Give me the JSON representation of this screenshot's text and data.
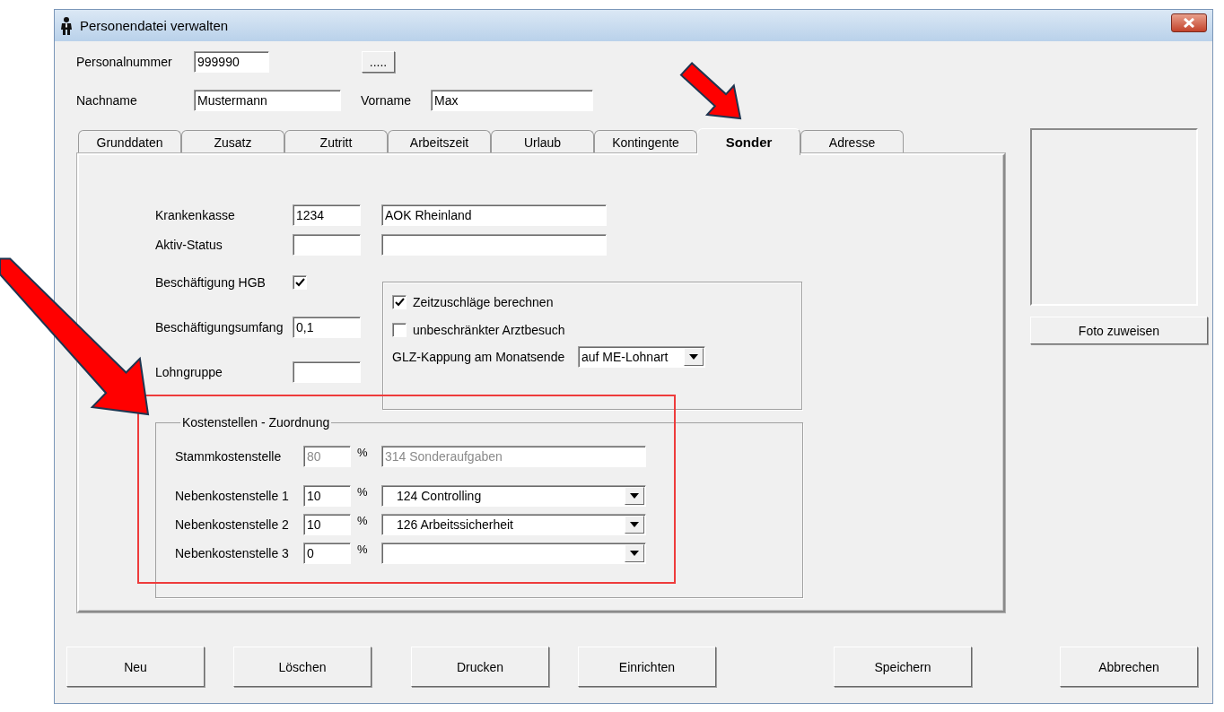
{
  "window": {
    "title": "Personendatei verwalten"
  },
  "header": {
    "personalnummer": {
      "label": "Personalnummer",
      "value": "999990"
    },
    "lookup_button": ".....",
    "nachname": {
      "label": "Nachname",
      "value": "Mustermann"
    },
    "vorname": {
      "label": "Vorname",
      "value": "Max"
    }
  },
  "tabs": [
    {
      "label": "Grunddaten",
      "selected": false
    },
    {
      "label": "Zusatz",
      "selected": false
    },
    {
      "label": "Zutritt",
      "selected": false
    },
    {
      "label": "Arbeitszeit",
      "selected": false
    },
    {
      "label": "Urlaub",
      "selected": false
    },
    {
      "label": "Kontingente",
      "selected": false
    },
    {
      "label": "Sonder",
      "selected": true
    },
    {
      "label": "Adresse",
      "selected": false
    }
  ],
  "sonder": {
    "krankenkasse": {
      "label": "Krankenkasse",
      "code": "1234",
      "name": "AOK Rheinland"
    },
    "aktiv_status": {
      "label": "Aktiv-Status"
    },
    "beschaeftigung_hgb": {
      "label": "Beschäftigung HGB",
      "checked": true
    },
    "beschaeftigungsumfang": {
      "label": "Beschäftigungsumfang",
      "value": "0,1"
    },
    "lohngruppe": {
      "label": "Lohngruppe"
    },
    "options": [
      {
        "label": "Zeitzuschläge berechnen",
        "checked": true
      },
      {
        "label": "unbeschränkter Arztbesuch",
        "checked": false
      }
    ],
    "glz_kappung": {
      "label": "GLZ-Kappung am Monatsende",
      "value": "auf ME-Lohnart"
    },
    "kostenstellen": {
      "title": "Kostenstellen - Zuordnung",
      "stamm": {
        "label": "Stammkostenstelle",
        "percent": "80",
        "unit": "%",
        "name": "314 Sonderaufgaben",
        "disabled": true
      },
      "neben": [
        {
          "label": "Nebenkostenstelle 1",
          "percent": "10",
          "unit": "%",
          "value": "124 Controlling"
        },
        {
          "label": "Nebenkostenstelle 2",
          "percent": "10",
          "unit": "%",
          "value": "126 Arbeitssicherheit"
        },
        {
          "label": "Nebenkostenstelle 3",
          "percent": "0",
          "unit": "%"
        }
      ]
    }
  },
  "photo": {
    "button": "Foto zuweisen"
  },
  "buttons": [
    "Neu",
    "Löschen",
    "Drucken",
    "Einrichten",
    "Speichern",
    "Abbrechen"
  ]
}
